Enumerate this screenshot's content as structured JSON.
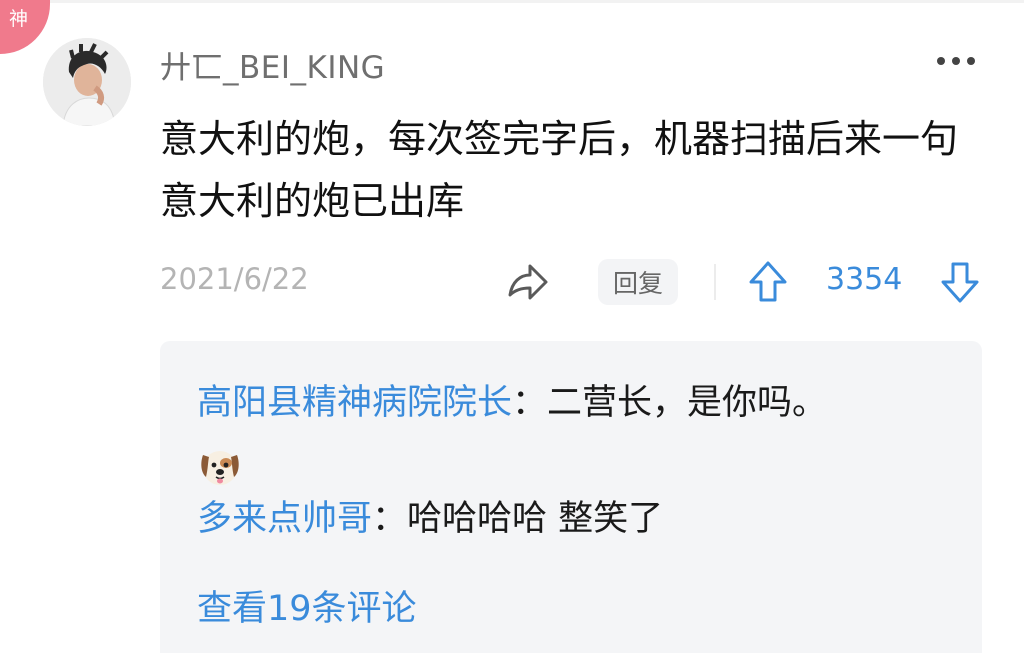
{
  "badge": {
    "label": "神",
    "color": "#f07a8c"
  },
  "comment": {
    "username": "廾匸_BEI_KING",
    "avatar_icon": "user-avatar",
    "content": "意大利的炮，每次签完字后，机器扫描后来一句意大利的炮已出库",
    "timestamp": "2021/6/22",
    "actions": {
      "share_icon": "share-arrow-icon",
      "reply_label": "回复",
      "upvote_icon": "arrow-up-icon",
      "vote_count": "3354",
      "downvote_icon": "arrow-down-icon"
    }
  },
  "replies": [
    {
      "author": "高阳县精神病院院长",
      "separator": "：",
      "text": "二营长，是你吗。",
      "emoji_icon": "dog-face-emoji"
    },
    {
      "author": "多来点帅哥",
      "separator": "：",
      "text": "哈哈哈哈 整笑了"
    }
  ],
  "view_more": "查看19条评论",
  "colors": {
    "accent": "#3a8bdb",
    "muted": "#b4b4b4",
    "reply_background": "#f4f5f7"
  }
}
